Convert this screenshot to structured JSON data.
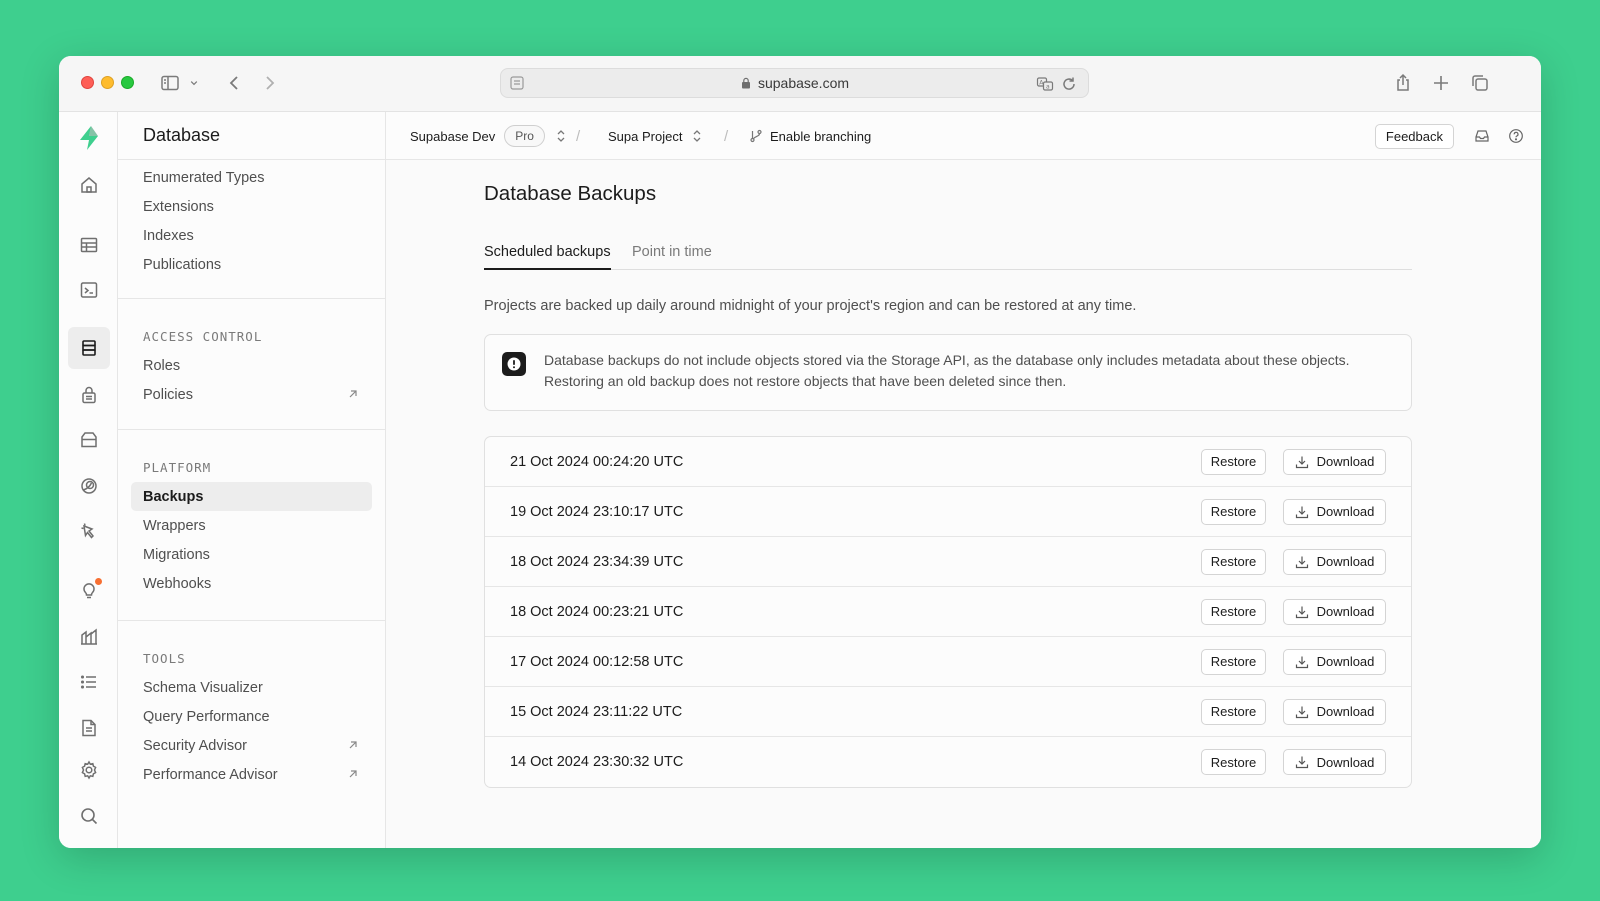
{
  "browser": {
    "url": "supabase.com"
  },
  "sidemenu": {
    "title": "Database",
    "top_items": [
      "Enumerated Types",
      "Extensions",
      "Indexes",
      "Publications"
    ],
    "access_control": {
      "heading": "ACCESS CONTROL",
      "items": [
        "Roles",
        "Policies"
      ]
    },
    "platform": {
      "heading": "PLATFORM",
      "items": [
        "Backups",
        "Wrappers",
        "Migrations",
        "Webhooks"
      ],
      "active": "Backups"
    },
    "tools": {
      "heading": "TOOLS",
      "items": [
        "Schema Visualizer",
        "Query Performance",
        "Security Advisor",
        "Performance Advisor"
      ]
    }
  },
  "topbar": {
    "org": "Supabase Dev",
    "plan": "Pro",
    "project": "Supa Project",
    "branching": "Enable branching",
    "feedback": "Feedback"
  },
  "main": {
    "title": "Database Backups",
    "tabs": [
      "Scheduled backups",
      "Point in time"
    ],
    "active_tab": "Scheduled backups",
    "description": "Projects are backed up daily around midnight of your project's region and can be restored at any time.",
    "alert": {
      "line1": "Database backups do not include objects stored via the Storage API, as the database only includes metadata about these objects.",
      "line2": "Restoring an old backup does not restore objects that have been deleted since then."
    },
    "restore_label": "Restore",
    "download_label": "Download",
    "backups": [
      "21 Oct 2024 00:24:20 UTC",
      "19 Oct 2024 23:10:17 UTC",
      "18 Oct 2024 23:34:39 UTC",
      "18 Oct 2024 00:23:21 UTC",
      "17 Oct 2024 00:12:58 UTC",
      "15 Oct 2024 23:11:22 UTC",
      "14 Oct 2024 23:30:32 UTC"
    ]
  },
  "colors": {
    "background": "#3ecf8e",
    "brand": "#3ecf8e",
    "notification": "#f76f32"
  },
  "icons": {
    "rail": [
      "supabase-logo-icon",
      "home-icon",
      "table-editor-icon",
      "sql-editor-icon",
      "database-icon",
      "auth-lock-icon",
      "storage-icon",
      "edge-functions-icon",
      "realtime-icon",
      "advisors-bulb-icon",
      "reports-icon",
      "logs-icon",
      "api-docs-icon",
      "settings-gear-icon",
      "search-icon"
    ]
  }
}
